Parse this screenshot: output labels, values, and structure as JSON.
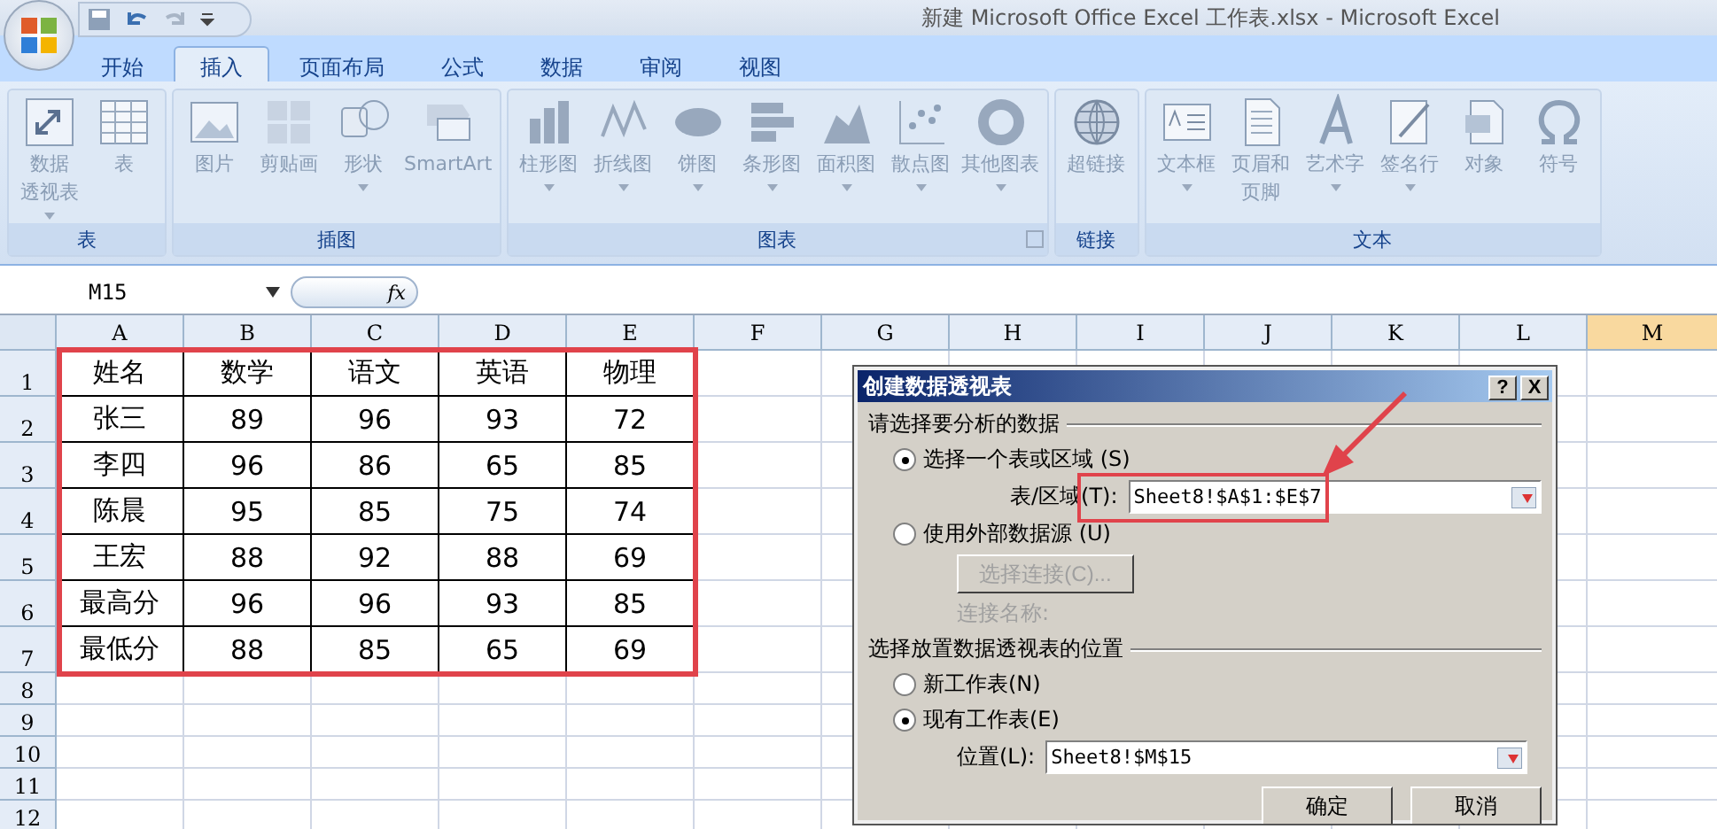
{
  "app": {
    "title": "新建 Microsoft Office Excel 工作表.xlsx - Microsoft Excel"
  },
  "tabs": [
    {
      "label": "开始",
      "selected": false
    },
    {
      "label": "插入",
      "selected": true
    },
    {
      "label": "页面布局",
      "selected": false
    },
    {
      "label": "公式",
      "selected": false
    },
    {
      "label": "数据",
      "selected": false
    },
    {
      "label": "审阅",
      "selected": false
    },
    {
      "label": "视图",
      "selected": false
    }
  ],
  "ribbon": {
    "groups": [
      {
        "title": "表",
        "items": [
          {
            "lines": [
              "数据",
              "透视表"
            ],
            "dropdown": true
          },
          {
            "lines": [
              "表"
            ]
          }
        ]
      },
      {
        "title": "插图",
        "items": [
          {
            "lines": [
              "图片"
            ]
          },
          {
            "lines": [
              "剪贴画"
            ]
          },
          {
            "lines": [
              "形状"
            ],
            "dropdown": true
          },
          {
            "lines": [
              "SmartArt"
            ]
          }
        ]
      },
      {
        "title": "图表",
        "launcher": true,
        "items": [
          {
            "lines": [
              "柱形图"
            ],
            "dropdown": true
          },
          {
            "lines": [
              "折线图"
            ],
            "dropdown": true
          },
          {
            "lines": [
              "饼图"
            ],
            "dropdown": true
          },
          {
            "lines": [
              "条形图"
            ],
            "dropdown": true
          },
          {
            "lines": [
              "面积图"
            ],
            "dropdown": true
          },
          {
            "lines": [
              "散点图"
            ],
            "dropdown": true
          },
          {
            "lines": [
              "其他图表"
            ],
            "dropdown": true
          }
        ]
      },
      {
        "title": "链接",
        "items": [
          {
            "lines": [
              "超链接"
            ]
          }
        ]
      },
      {
        "title": "文本",
        "items": [
          {
            "lines": [
              "文本框"
            ],
            "dropdown": true
          },
          {
            "lines": [
              "页眉和",
              "页脚"
            ]
          },
          {
            "lines": [
              "艺术字"
            ],
            "dropdown": true
          },
          {
            "lines": [
              "签名行"
            ],
            "dropdown": true
          },
          {
            "lines": [
              "对象"
            ]
          },
          {
            "lines": [
              "符号"
            ]
          }
        ]
      }
    ]
  },
  "formula_bar": {
    "name_box": "M15",
    "fx": "fx"
  },
  "sheet": {
    "columns": [
      {
        "label": "A",
        "selected": false
      },
      {
        "label": "B",
        "selected": false
      },
      {
        "label": "C",
        "selected": false
      },
      {
        "label": "D",
        "selected": false
      },
      {
        "label": "E",
        "selected": false
      },
      {
        "label": "F",
        "selected": false
      },
      {
        "label": "G",
        "selected": false
      },
      {
        "label": "H",
        "selected": false
      },
      {
        "label": "I",
        "selected": false
      },
      {
        "label": "J",
        "selected": false
      },
      {
        "label": "K",
        "selected": false
      },
      {
        "label": "L",
        "selected": false
      },
      {
        "label": "M",
        "selected": true
      }
    ],
    "rows": [
      {
        "number": "1",
        "cells": [
          "姓名",
          "数学",
          "语文",
          "英语",
          "物理"
        ]
      },
      {
        "number": "2",
        "cells": [
          "张三",
          "89",
          "96",
          "93",
          "72"
        ]
      },
      {
        "number": "3",
        "cells": [
          "李四",
          "96",
          "86",
          "65",
          "85"
        ]
      },
      {
        "number": "4",
        "cells": [
          "陈晨",
          "95",
          "85",
          "75",
          "74"
        ]
      },
      {
        "number": "5",
        "cells": [
          "王宏",
          "88",
          "92",
          "88",
          "69"
        ]
      },
      {
        "number": "6",
        "cells": [
          "最高分",
          "96",
          "96",
          "93",
          "85"
        ]
      },
      {
        "number": "7",
        "cells": [
          "最低分",
          "88",
          "85",
          "65",
          "69"
        ]
      },
      {
        "number": "8",
        "cells": []
      },
      {
        "number": "9",
        "cells": []
      },
      {
        "number": "10",
        "cells": []
      },
      {
        "number": "11",
        "cells": []
      },
      {
        "number": "12",
        "cells": []
      }
    ]
  },
  "dialog": {
    "title": "创建数据透视表",
    "help": "?",
    "close": "X",
    "section_1": "请选择要分析的数据",
    "source_options": [
      {
        "label": "选择一个表或区域 (S)",
        "selected": true
      },
      {
        "label": "使用外部数据源 (U)",
        "selected": false
      }
    ],
    "range_label": "表/区域(T):",
    "range_value": "Sheet8!$A$1:$E$7",
    "connection_button": {
      "label": "选择连接(C)...",
      "disabled": true
    },
    "connection_name": "连接名称:",
    "section_2": "选择放置数据透视表的位置",
    "location_options": [
      {
        "label": "新工作表(N)",
        "selected": false
      },
      {
        "label": "现有工作表(E)",
        "selected": true
      }
    ],
    "location_label": "位置(L):",
    "location_value": "Sheet8!$M$15",
    "ok": "确定",
    "cancel": "取消"
  }
}
